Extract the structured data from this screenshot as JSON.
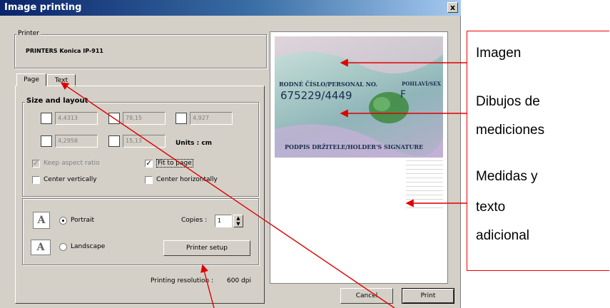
{
  "window": {
    "title": "Image printing",
    "close_glyph": "x"
  },
  "printer": {
    "legend": "Printer",
    "name": "PRINTERS Konica IP-911"
  },
  "tabs": [
    {
      "label": "Page"
    },
    {
      "label": "Text"
    }
  ],
  "size_layout": {
    "legend": "Size and layout",
    "fields": [
      "4,4313",
      "78,15",
      "4,927",
      "4,2958",
      "15,13"
    ],
    "units": "Units : cm",
    "keep_aspect": "Keep aspect ratio",
    "fit_to_page": "Fit to page",
    "center_vertically": "Center vertically",
    "center_horizontally": "Center horizontally"
  },
  "orientation": {
    "portrait": "Portrait",
    "landscape": "Landscape",
    "copies_label": "Copies :",
    "copies_value": "1",
    "printer_setup": "Printer setup",
    "page_glyph": "A"
  },
  "resolution": {
    "label": "Printing resolution :",
    "value": "600 dpi"
  },
  "buttons": {
    "cancel": "Cancel",
    "print": "Print"
  },
  "preview": {
    "line1": "RODNÉ ČÍSLO/PERSONAL NO.",
    "sex_label": "POHLAVÍ/SEX",
    "number": "675229/4449",
    "sex": "F",
    "signature": "PODPIS DRŽITELE/HOLDER'S SIGNATURE"
  },
  "annotations": {
    "imagen": "Imagen",
    "dibujos_1": "Dibujos de",
    "dibujos_2": "mediciones",
    "medidas_1": "Medidas y",
    "medidas_2": "texto",
    "medidas_3": "adicional"
  },
  "colors": {
    "annotation": "#e00000",
    "titlebar": "#0a246a",
    "dialog": "#d4d0c8"
  }
}
